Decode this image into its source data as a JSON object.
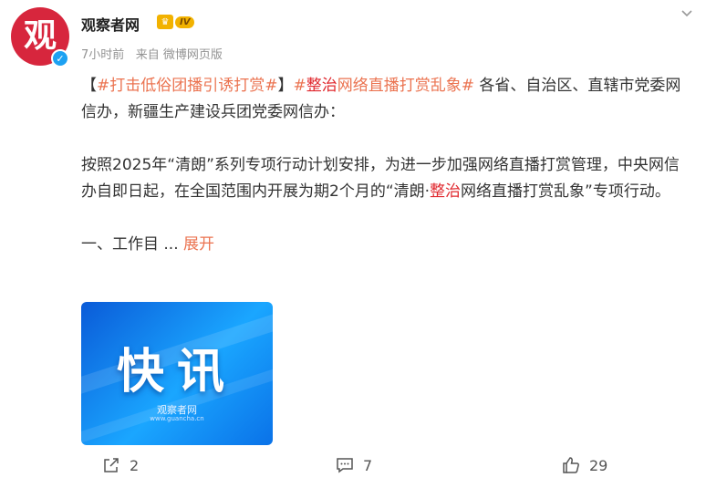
{
  "header": {
    "avatar_text": "观",
    "user_name": "观察者网",
    "vip_level": "IV",
    "time": "7小时前",
    "source": "来自 微博网页版"
  },
  "post": {
    "line1_prefix": "【",
    "topic1": "#打击低俗团播引诱打赏#",
    "line1_mid": "】",
    "topic2_hash": "#",
    "topic2_hl": "整治",
    "topic2_rest": "网络直播打赏乱象#",
    "line1_text": " 各省、自治区、直辖市党委网信办，新疆生产建设兵团党委网信办：",
    "para2_a": "按照2025年“清朗”系列专项行动计划安排，为进一步加强网络直播打赏管理，中央网信办自即日起，在全国范围内开展为期2个月的“清朗·",
    "para2_hl": "整治",
    "para2_b": "网络直播打赏乱象”专项行动。",
    "para3": "一、工作目 ... ",
    "expand": "展开"
  },
  "thumbnail": {
    "title": "快讯",
    "brand": "观察者网",
    "url": "www.guancha.cn"
  },
  "actions": {
    "share_count": "2",
    "comment_count": "7",
    "like_count": "29"
  },
  "colors": {
    "accent": "#eb7350",
    "highlight": "#e0282e",
    "avatar_bg": "#d7263d",
    "verify": "#1da1f2"
  }
}
